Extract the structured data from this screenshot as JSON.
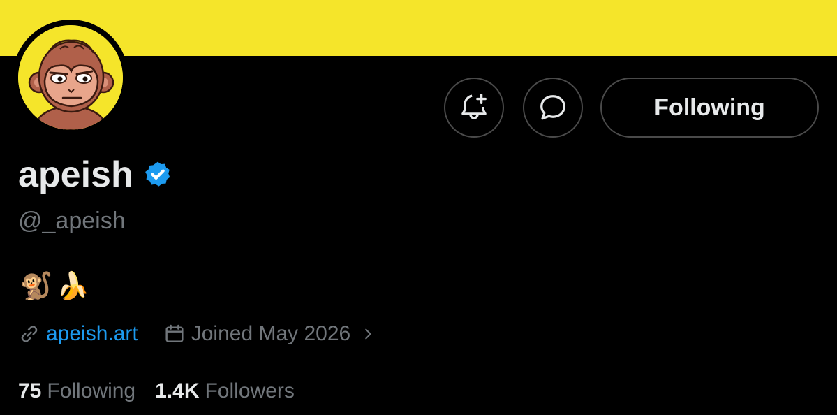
{
  "profile": {
    "display_name": "apeish",
    "handle": "@_apeish",
    "bio": [
      "🐒",
      "🍌"
    ],
    "website": "apeish.art",
    "joined": "Joined May 2026"
  },
  "actions": {
    "follow_label": "Following"
  },
  "stats": {
    "following_count": "75",
    "following_label": "Following",
    "followers_count": "1.4K",
    "followers_label": "Followers"
  },
  "colors": {
    "banner": "#f5e52a",
    "background": "#000000",
    "accent": "#1d9bf0",
    "text_primary": "#e7e9ea",
    "text_secondary": "#71767b"
  },
  "icons": {
    "notify": "bell-plus-icon",
    "message": "message-bubble-icon",
    "verified": "verified-badge-icon",
    "link": "link-icon",
    "calendar": "calendar-icon",
    "chevron": "chevron-right-icon"
  }
}
